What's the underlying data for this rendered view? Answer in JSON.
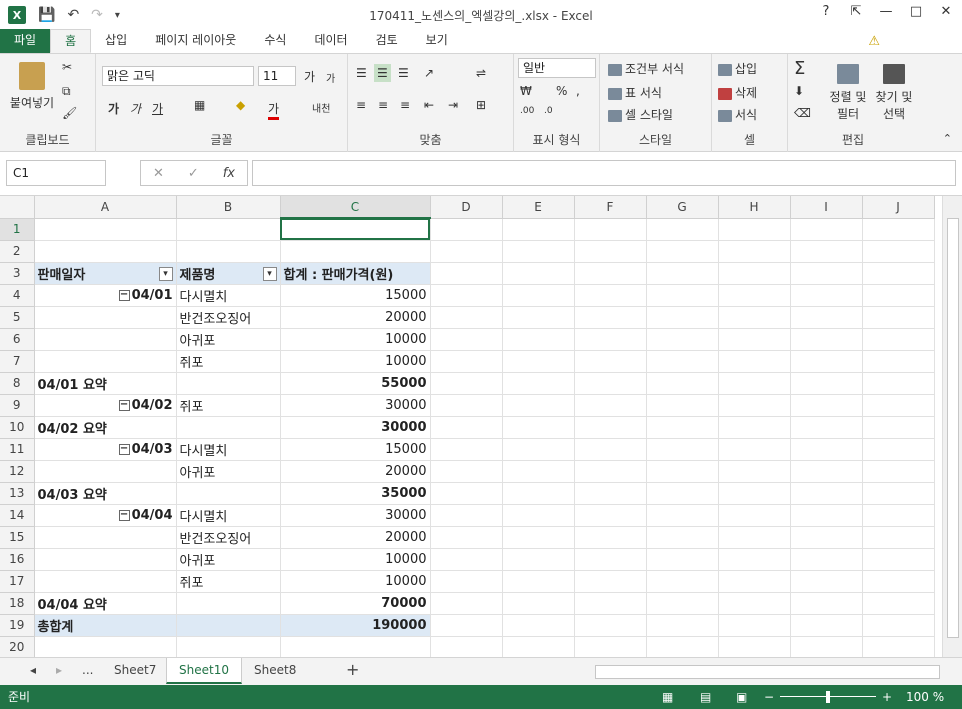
{
  "window": {
    "title": "170411_노센스의_엑셀강의_.xlsx - Excel",
    "help": "?",
    "min": "—",
    "restore": "□",
    "close": "✕"
  },
  "tabs": [
    "파일",
    "홈",
    "삽입",
    "페이지 레이아웃",
    "수식",
    "데이터",
    "검토",
    "보기"
  ],
  "ribbon": {
    "clipboard": {
      "label": "클립보드",
      "paste": "붙여넣기"
    },
    "font": {
      "label": "글꼴",
      "name": "맑은 고딕",
      "size": "11",
      "bold": "가",
      "italic": "가",
      "underline": "가",
      "grow": "가",
      "shrink": "가",
      "color": "가",
      "phonetic": "내천"
    },
    "align": {
      "label": "맞춤"
    },
    "number": {
      "label": "표시 형식",
      "format": "일반",
      "percent": "%"
    },
    "styles": {
      "label": "스타일",
      "cond": "조건부 서식",
      "table": "표 서식",
      "cell": "셀 스타일"
    },
    "cells": {
      "label": "셀",
      "insert": "삽입",
      "delete": "삭제",
      "format": "서식"
    },
    "edit": {
      "label": "편집",
      "sort": "정렬 및 필터",
      "find": "찾기 및 선택"
    }
  },
  "namebox": "C1",
  "columns": [
    "A",
    "B",
    "C",
    "D",
    "E",
    "F",
    "G",
    "H",
    "I",
    "J"
  ],
  "rows": [
    {
      "n": "1",
      "a": "",
      "b": "",
      "c": ""
    },
    {
      "n": "2",
      "a": "",
      "b": "",
      "c": ""
    },
    {
      "n": "3",
      "a": "판매일자",
      "b": "제품명",
      "c": "합계 : 판매가격(원)"
    },
    {
      "n": "4",
      "a": "04/01",
      "b": "다시멸치",
      "c": "15000"
    },
    {
      "n": "5",
      "a": "",
      "b": "반건조오징어",
      "c": "20000"
    },
    {
      "n": "6",
      "a": "",
      "b": "아귀포",
      "c": "10000"
    },
    {
      "n": "7",
      "a": "",
      "b": "쥐포",
      "c": "10000"
    },
    {
      "n": "8",
      "a": "04/01 요약",
      "b": "",
      "c": "55000"
    },
    {
      "n": "9",
      "a": "04/02",
      "b": "쥐포",
      "c": "30000"
    },
    {
      "n": "10",
      "a": "04/02 요약",
      "b": "",
      "c": "30000"
    },
    {
      "n": "11",
      "a": "04/03",
      "b": "다시멸치",
      "c": "15000"
    },
    {
      "n": "12",
      "a": "",
      "b": "아귀포",
      "c": "20000"
    },
    {
      "n": "13",
      "a": "04/03 요약",
      "b": "",
      "c": "35000"
    },
    {
      "n": "14",
      "a": "04/04",
      "b": "다시멸치",
      "c": "30000"
    },
    {
      "n": "15",
      "a": "",
      "b": "반건조오징어",
      "c": "20000"
    },
    {
      "n": "16",
      "a": "",
      "b": "아귀포",
      "c": "10000"
    },
    {
      "n": "17",
      "a": "",
      "b": "쥐포",
      "c": "10000"
    },
    {
      "n": "18",
      "a": "04/04 요약",
      "b": "",
      "c": "70000"
    },
    {
      "n": "19",
      "a": "총합계",
      "b": "",
      "c": "190000"
    },
    {
      "n": "20",
      "a": "",
      "b": "",
      "c": ""
    }
  ],
  "sheets": {
    "more": "...",
    "s1": "Sheet7",
    "s2": "Sheet10",
    "s3": "Sheet8",
    "add": "+"
  },
  "status": {
    "ready": "준비",
    "zoom": "100 %"
  }
}
